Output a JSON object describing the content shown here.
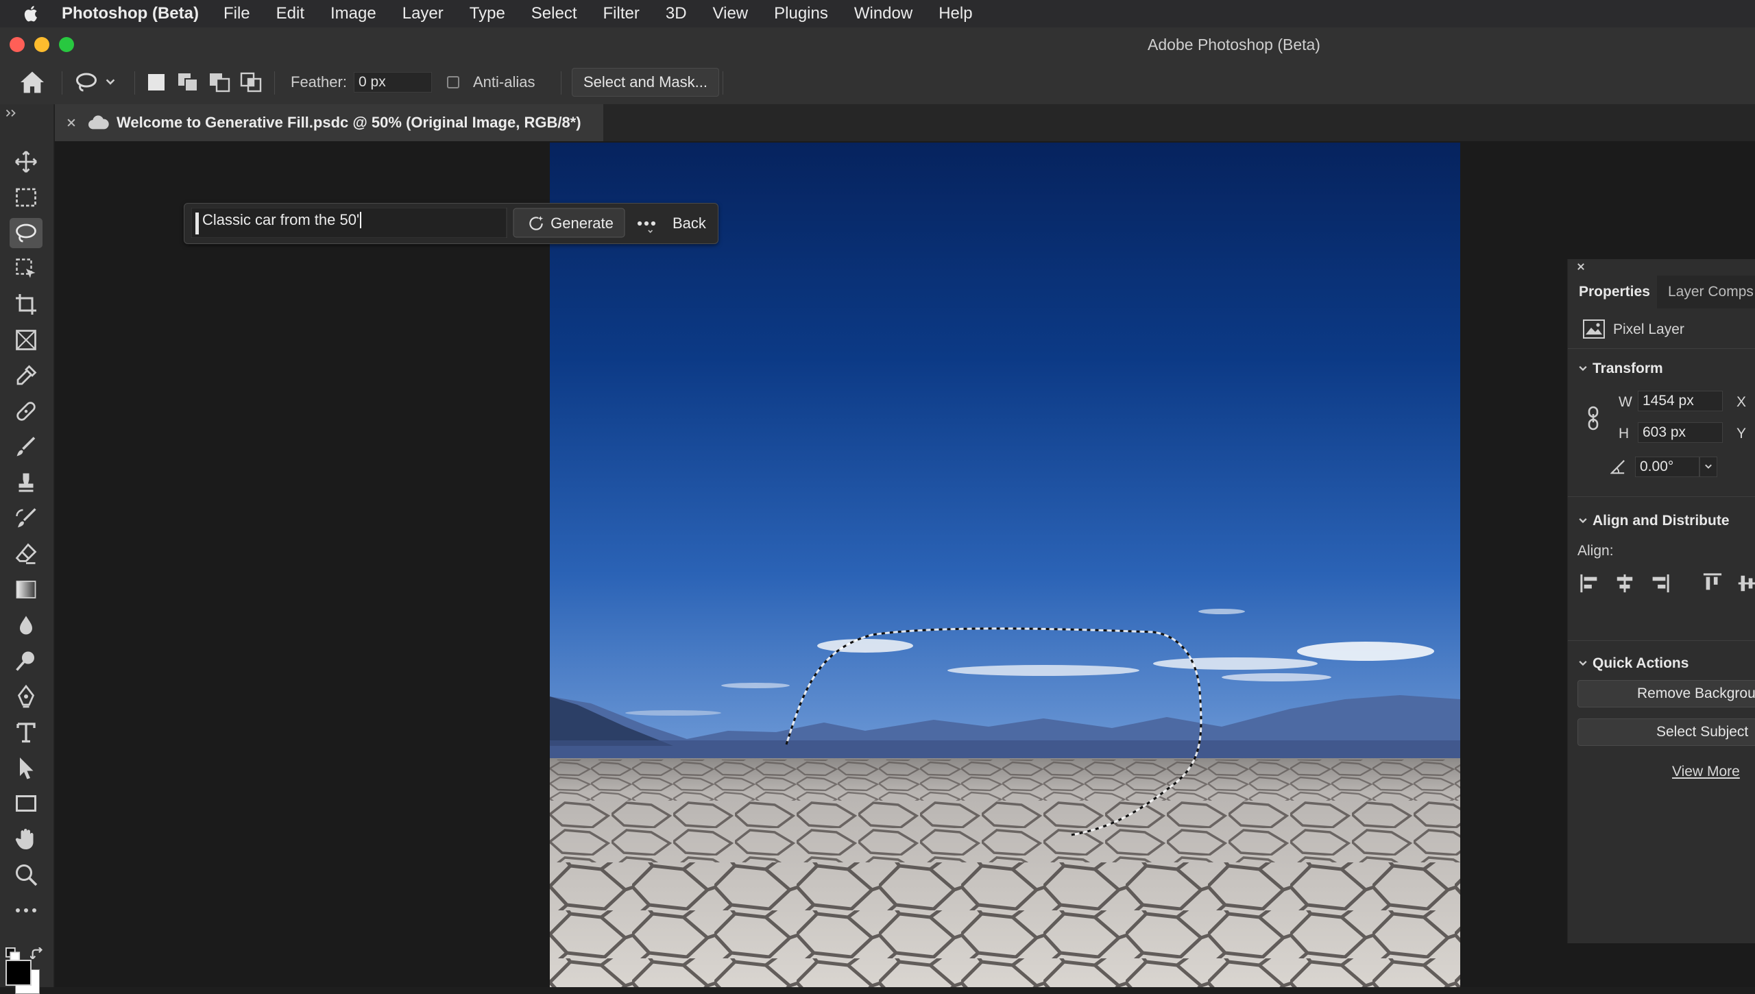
{
  "menubar": {
    "app_name": "Photoshop (Beta)",
    "items": [
      "File",
      "Edit",
      "Image",
      "Layer",
      "Type",
      "Select",
      "Filter",
      "3D",
      "View",
      "Plugins",
      "Window",
      "Help"
    ]
  },
  "window": {
    "title": "Adobe Photoshop (Beta)"
  },
  "options_bar": {
    "feather_label": "Feather:",
    "feather_value": "0 px",
    "anti_alias_label": "Anti-alias",
    "select_mask_label": "Select and Mask..."
  },
  "document_tab": {
    "title": "Welcome to Generative Fill.psdc @ 50% (Original Image, RGB/8*)"
  },
  "task_bar": {
    "prompt_value": "Classic car from the 50'",
    "generate_label": "Generate",
    "back_label": "Back"
  },
  "properties_panel": {
    "tabs": [
      "Properties",
      "Layer Comps"
    ],
    "layer_type": "Pixel Layer",
    "transform": {
      "title": "Transform",
      "w_label": "W",
      "w_value": "1454 px",
      "x_label": "X",
      "h_label": "H",
      "h_value": "603 px",
      "y_label": "Y",
      "angle_value": "0.00°"
    },
    "align": {
      "title": "Align and Distribute",
      "align_label": "Align:"
    },
    "quick_actions": {
      "title": "Quick Actions",
      "remove_bg_label": "Remove Backgrou",
      "select_subject_label": "Select Subject",
      "view_more_label": "View More"
    }
  },
  "colors": {
    "accent_traffic_red": "#ff5f57",
    "accent_traffic_yellow": "#febc2e",
    "accent_traffic_green": "#28c840",
    "chrome_dark": "#323232",
    "sky_top": "#06235e",
    "sky_bottom": "#3f79c7"
  }
}
